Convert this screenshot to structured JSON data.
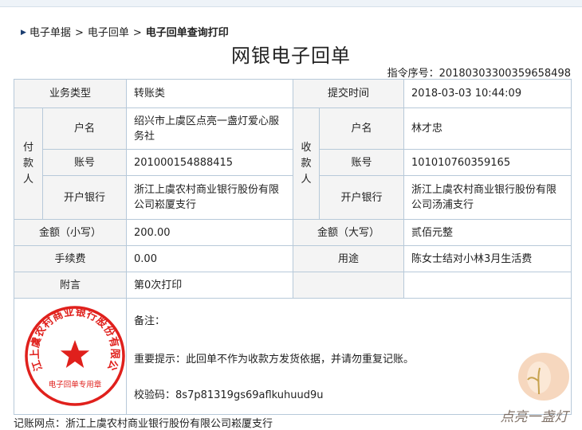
{
  "breadcrumb": {
    "items": [
      "电子单据",
      "电子回单"
    ],
    "separator": ">",
    "current": "电子回单查询打印"
  },
  "title": "网银电子回单",
  "serial": {
    "label": "指令序号：",
    "value": "20180303300359658498"
  },
  "table": {
    "business_type_label": "业务类型",
    "business_type_value": "转账类",
    "submit_time_label": "提交时间",
    "submit_time_value": "2018-03-03 10:44:09",
    "payer": {
      "side_label": "付款人",
      "name_label": "户名",
      "name_value": "绍兴市上虞区点亮一盏灯爱心服务社",
      "account_label": "账号",
      "account_value": "201000154888415",
      "bank_label": "开户银行",
      "bank_value": "浙江上虞农村商业银行股份有限公司崧厦支行"
    },
    "payee": {
      "side_label": "收款人",
      "name_label": "户名",
      "name_value": "林才忠",
      "account_label": "账号",
      "account_value": "101010760359165",
      "bank_label": "开户银行",
      "bank_value": "浙江上虞农村商业银行股份有限公司汤浦支行"
    },
    "amount_small_label": "金额（小写）",
    "amount_small_value": "200.00",
    "amount_big_label": "金额（大写）",
    "amount_big_value": "贰佰元整",
    "fee_label": "手续费",
    "fee_value": "0.00",
    "purpose_label": "用途",
    "purpose_value": "陈女士结对小林3月生活费",
    "remark_label": "附言",
    "remark_value": "第0次打印",
    "note_label": "备注：",
    "tip": "重要提示：此回单不作为收款方发货依据，并请勿重复记账。",
    "checksum_label": "校验码：",
    "checksum_value": "8s7p81319gs69aflkuhuud9u"
  },
  "seal": {
    "ring_text": "浙江上虞农村商业银行股份有限公司",
    "bottom_text": "电子回单专用章",
    "color": "#e0201c"
  },
  "footer": "记账网点：浙江上虞农村商业银行股份有限公司崧厦支行",
  "watermark": {
    "text": "点亮一盏灯"
  },
  "colors": {
    "border": "#b7c9d9",
    "label_bg": "#f4f4f4",
    "breadcrumb_arrow": "#1a3d70"
  }
}
